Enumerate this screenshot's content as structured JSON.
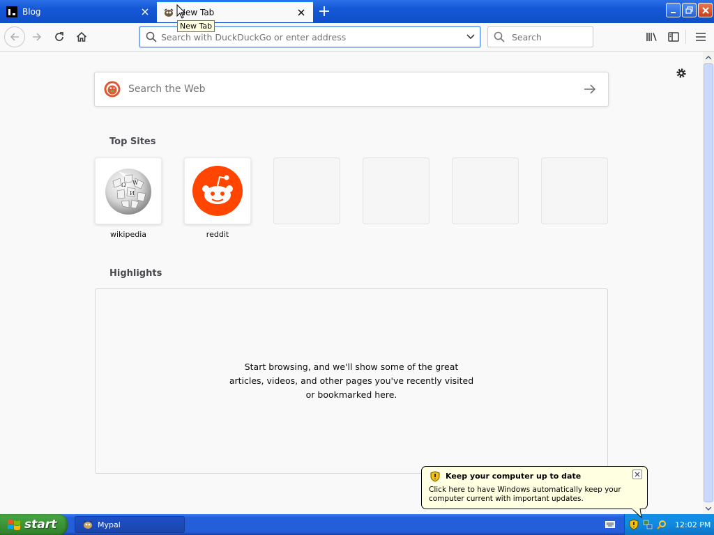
{
  "tabs": [
    {
      "label": "Blog",
      "active": false
    },
    {
      "label": "New Tab",
      "active": true
    }
  ],
  "tooltip": "New Tab",
  "urlbar": {
    "placeholder": "Search with DuckDuckGo or enter address"
  },
  "searchbar": {
    "placeholder": "Search"
  },
  "newtab": {
    "web_search_placeholder": "Search the Web",
    "top_sites_title": "Top Sites",
    "top_sites": [
      {
        "label": "wikipedia",
        "icon": "wikipedia-globe-icon"
      },
      {
        "label": "reddit",
        "icon": "reddit-alien-icon"
      }
    ],
    "highlights_title": "Highlights",
    "highlights_empty": "Start browsing, and we'll show some of the great articles, videos, and other pages you've recently visited or bookmarked here."
  },
  "balloon": {
    "title": "Keep your computer up to date",
    "text": "Click here to have Windows automatically keep your computer current with important updates."
  },
  "taskbar": {
    "start_label": "start",
    "task_label": "Mypal",
    "clock": "12:02 PM"
  },
  "colors": {
    "accent": "#0a84ff",
    "reddit": "#ff4500",
    "taskbar": "#245edb",
    "start": "#3c9437"
  }
}
